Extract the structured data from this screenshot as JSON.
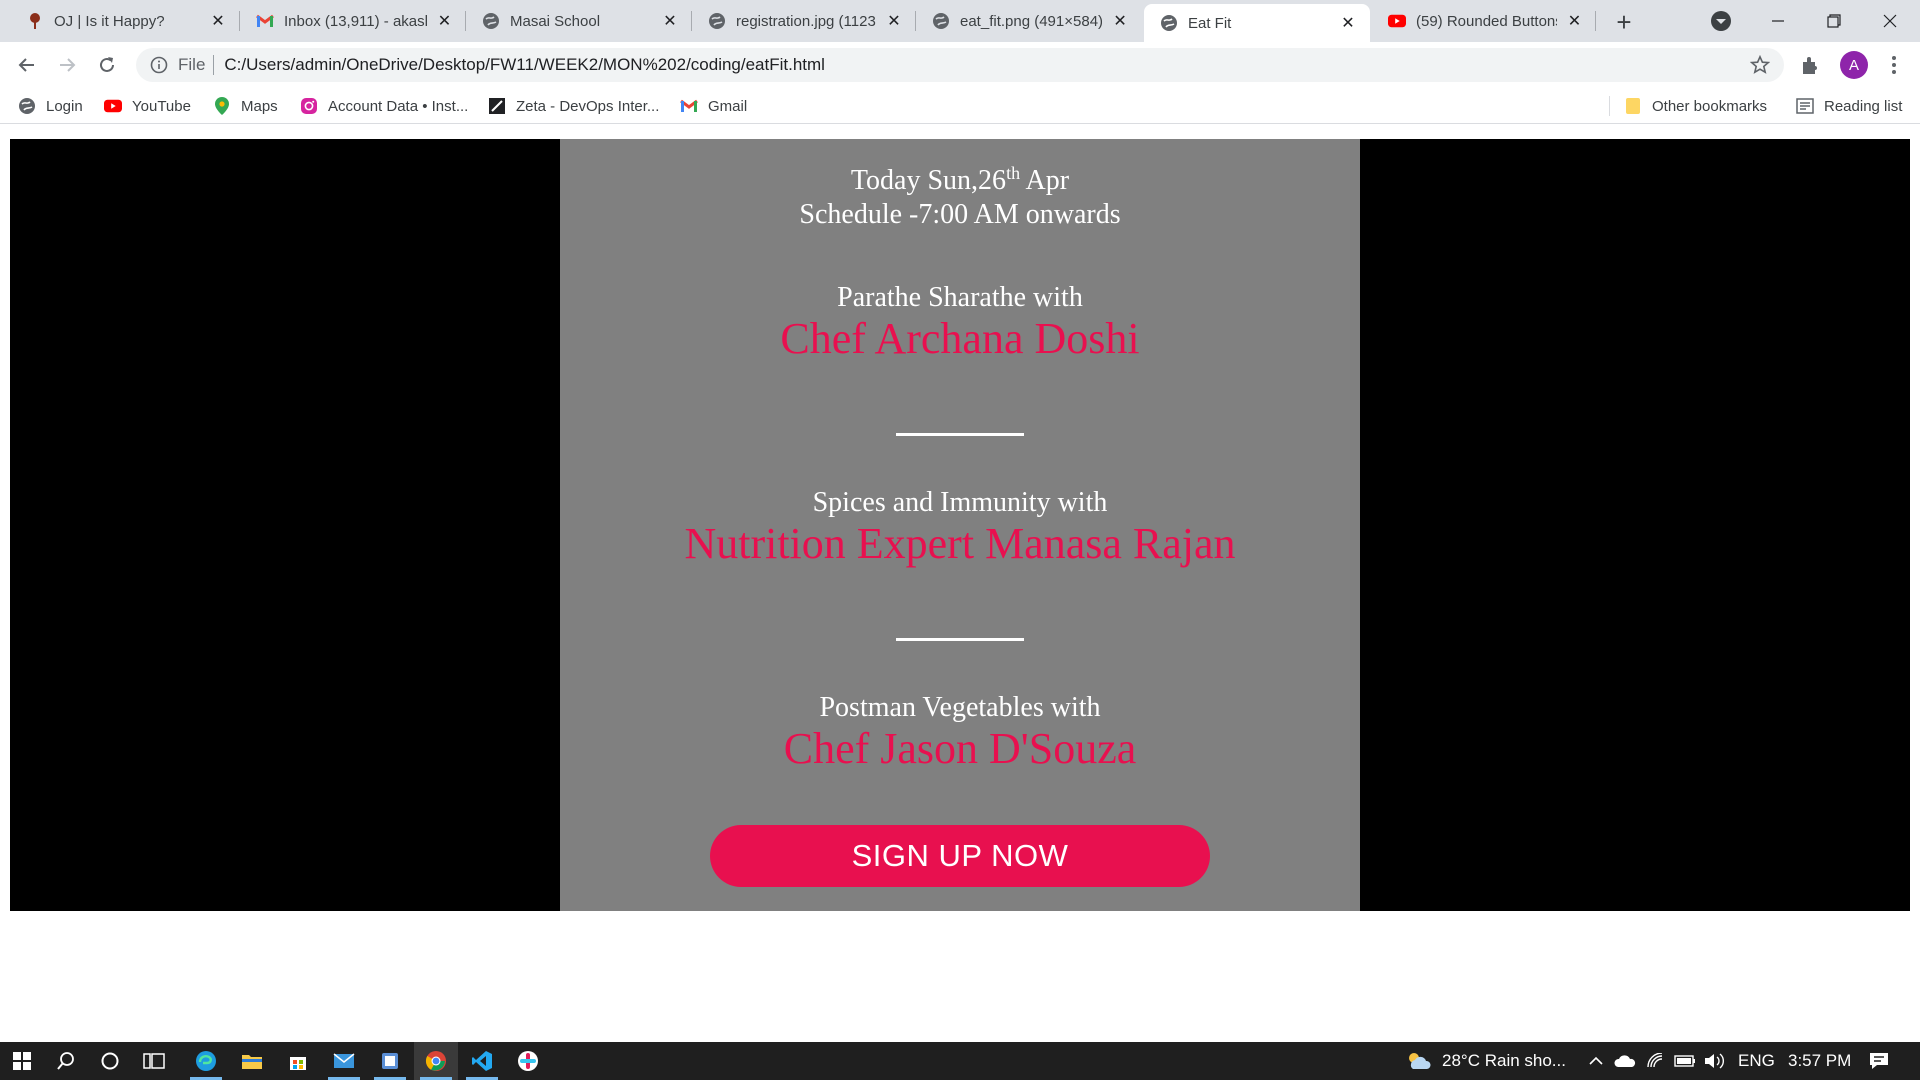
{
  "browser": {
    "tabs": [
      {
        "title": "OJ | Is it Happy?",
        "icon": "oj-icon"
      },
      {
        "title": "Inbox (13,911) - akash",
        "icon": "gmail-icon"
      },
      {
        "title": "Masai School",
        "icon": "globe-icon"
      },
      {
        "title": "registration.jpg (1123",
        "icon": "globe-icon"
      },
      {
        "title": "eat_fit.png (491×584)",
        "icon": "globe-icon"
      },
      {
        "title": "Eat Fit",
        "icon": "globe-icon",
        "active": true
      },
      {
        "title": "(59) Rounded Buttons",
        "icon": "youtube-icon"
      }
    ],
    "address": {
      "scheme_label": "File",
      "url": "C:/Users/admin/OneDrive/Desktop/FW11/WEEK2/MON%202/coding/eatFit.html"
    },
    "profile_initial": "A",
    "bookmarks": [
      {
        "label": "Login",
        "icon": "globe-icon"
      },
      {
        "label": "YouTube",
        "icon": "youtube-icon"
      },
      {
        "label": "Maps",
        "icon": "maps-pin-icon"
      },
      {
        "label": "Account Data • Inst...",
        "icon": "instagram-icon"
      },
      {
        "label": "Zeta - DevOps Inter...",
        "icon": "zeta-icon"
      },
      {
        "label": "Gmail",
        "icon": "gmail-icon"
      }
    ],
    "other_bookmarks": "Other bookmarks",
    "reading_list": "Reading list"
  },
  "page": {
    "date_prefix": "Today Sun,26",
    "date_sup": "th",
    "date_suffix": " Apr",
    "schedule": "Schedule -7:00 AM onwards",
    "sessions": [
      {
        "intro": "Parathe Sharathe with",
        "host": "Chef Archana Doshi"
      },
      {
        "intro": "Spices and Immunity with",
        "host": "Nutrition Expert Manasa Rajan"
      },
      {
        "intro": "Postman Vegetables with",
        "host": "Chef Jason D'Souza"
      }
    ],
    "signup_label": "SIGN UP NOW",
    "colors": {
      "card": "#808080",
      "accent": "#e8104f",
      "background": "#000000"
    }
  },
  "taskbar": {
    "weather": "28°C  Rain sho...",
    "language": "ENG",
    "time": "3:57 PM"
  }
}
